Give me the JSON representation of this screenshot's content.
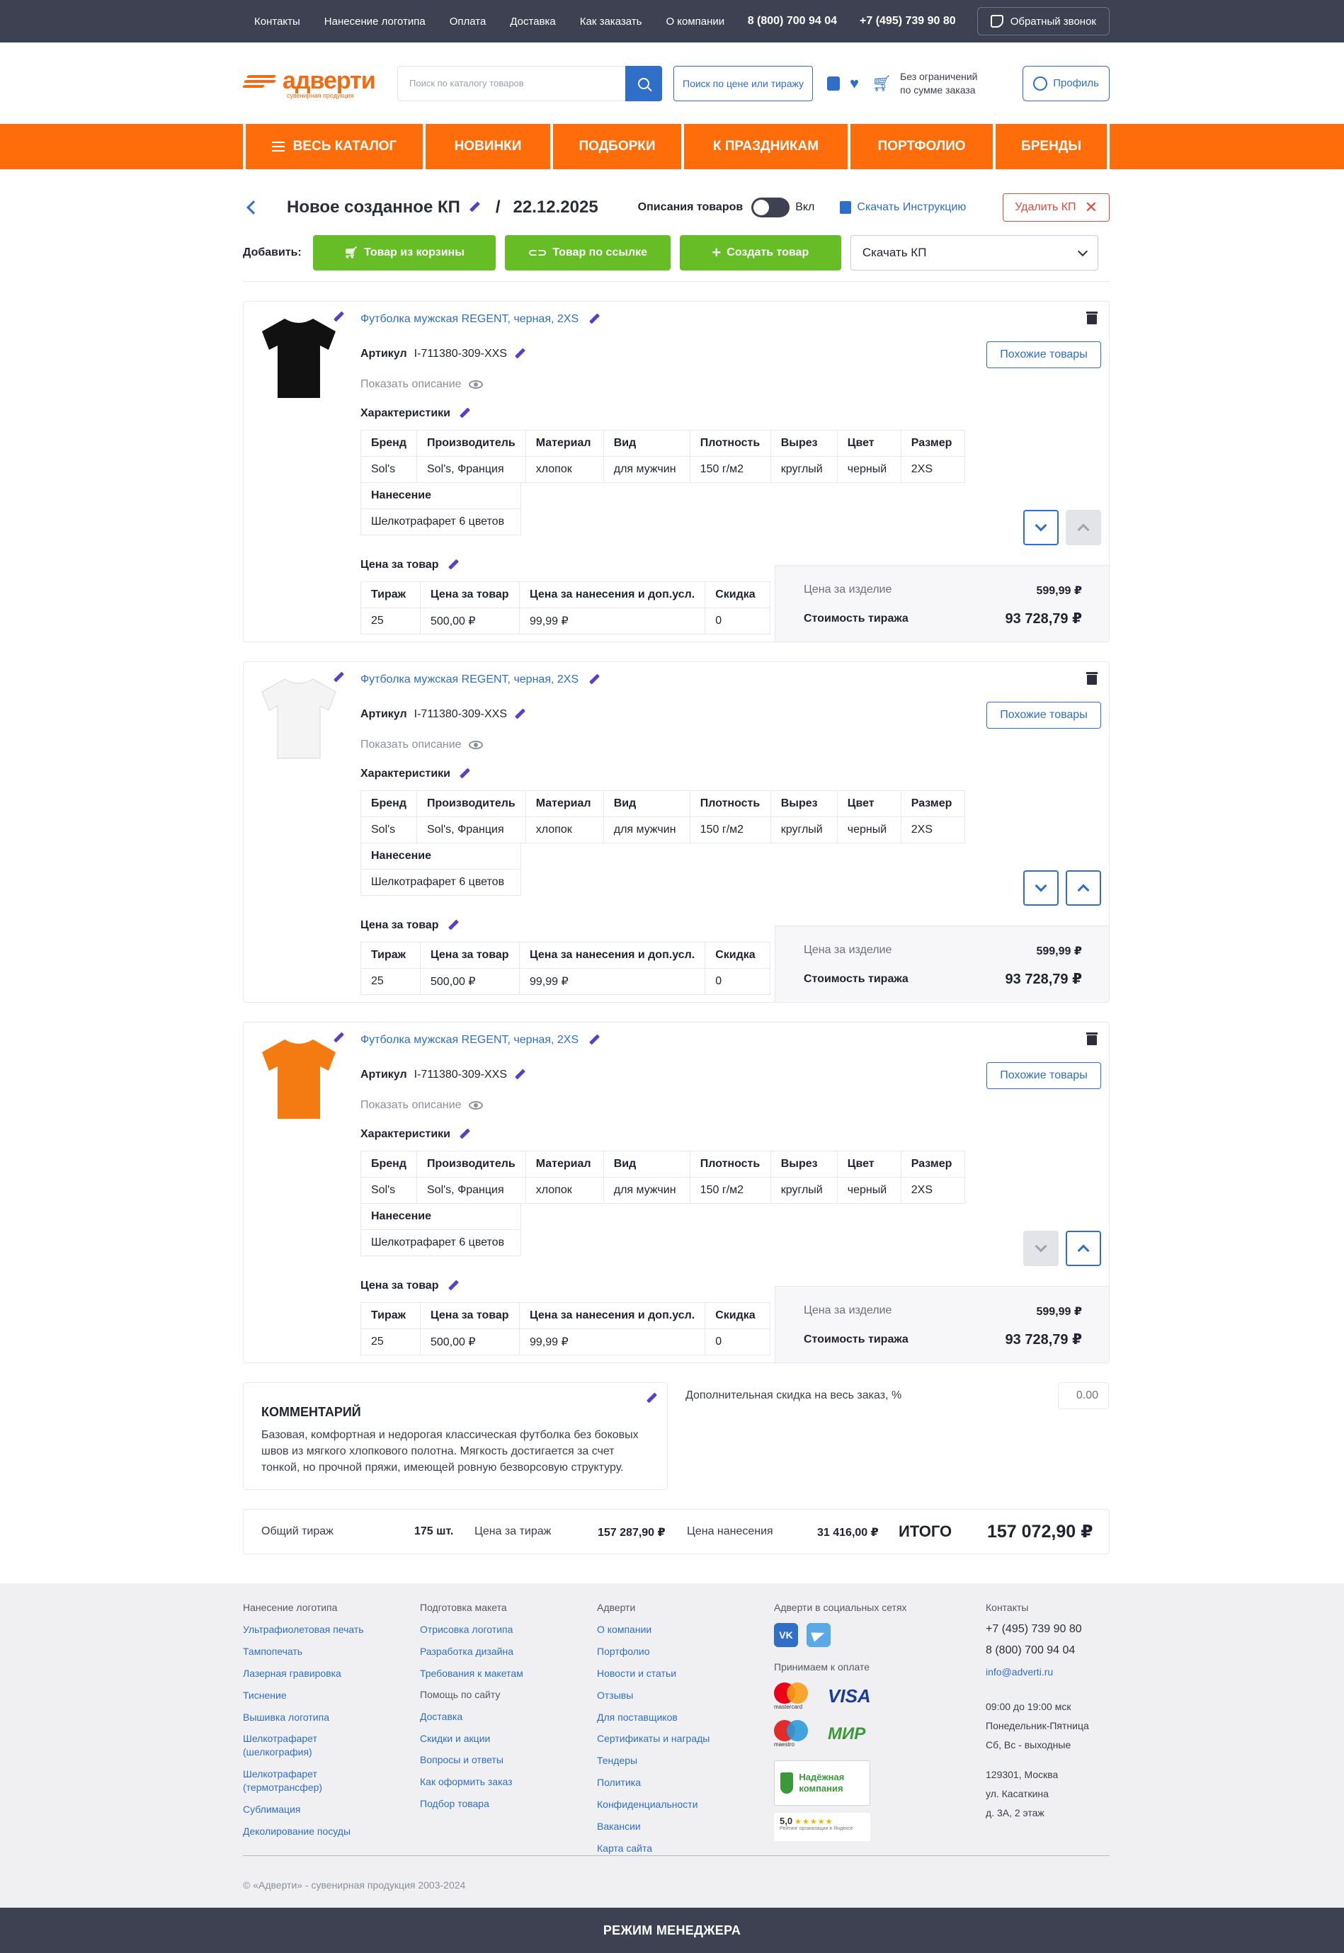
{
  "topbar": {
    "nav": [
      "Контакты",
      "Нанесение логотипа",
      "Оплата",
      "Доставка",
      "Как заказать",
      "О компании"
    ],
    "phone1": "8 (800) 700 94 04",
    "phone2": "+7 (495) 739 90 80",
    "callback": "Обратный звонок"
  },
  "header": {
    "logo_name": "адверти",
    "logo_sub": "сувенирная продукция",
    "search_placeholder": "Поиск по каталогу товаров",
    "price_search": "Поиск по цене или тиражу",
    "cart_line1": "Без ограничений",
    "cart_line2": "по сумме заказа",
    "profile": "Профиль"
  },
  "menu": [
    "ВЕСЬ КАТАЛОГ",
    "НОВИНКИ",
    "ПОДБОРКИ",
    "К ПРАЗДНИКАМ",
    "ПОРТФОЛИО",
    "БРЕНДЫ"
  ],
  "kp": {
    "title": "Новое созданное КП",
    "separator": "/",
    "date": "22.12.2025",
    "desc_label": "Описания товаров",
    "toggle_value": "Вкл",
    "instruction": "Скачать Инструкцию",
    "delete": "Удалить КП",
    "add_label": "Добавить:",
    "add_from_cart": "Товар из корзины",
    "add_by_link": "Товар по ссылке",
    "create_item": "Создать товар",
    "download": "Скачать КП"
  },
  "products": [
    {
      "name": "Футболка мужская REGENT, черная, 2XS",
      "sku_label": "Артикул",
      "sku": "I-711380-309-XXS",
      "shirt_color": "#111111",
      "similar": "Похожие товары",
      "show_desc": "Показать описание",
      "chars_title": "Характеристики",
      "chars_head": [
        "Бренд",
        "Производитель",
        "Материал",
        "Вид",
        "Плотность",
        "Вырез",
        "Цвет",
        "Размер"
      ],
      "chars_vals": [
        "Sol's",
        "Sol's, Франция",
        "хлопок",
        "для мужчин",
        "150 г/м2",
        "круглый",
        "черный",
        "2XS"
      ],
      "nanes_head": "Нанесение",
      "nanes_val": "Шелкотрафарет 6 цветов",
      "price_title": "Цена за товар",
      "price_head": [
        "Тираж",
        "Цена за товар",
        "Цена за нанесения и доп.усл.",
        "Скидка"
      ],
      "price_vals": [
        "25",
        "500,00 ₽",
        "99,99 ₽",
        "0"
      ],
      "unit_label": "Цена за изделие",
      "unit_price": "599,99 ₽",
      "total_label": "Стоимость тиража",
      "total": "93 728,79 ₽"
    },
    {
      "name": "Футболка мужская REGENT, черная, 2XS",
      "sku_label": "Артикул",
      "sku": "I-711380-309-XXS",
      "shirt_color": "#f4f4f4",
      "similar": "Похожие товары",
      "show_desc": "Показать описание",
      "chars_title": "Характеристики",
      "chars_head": [
        "Бренд",
        "Производитель",
        "Материал",
        "Вид",
        "Плотность",
        "Вырез",
        "Цвет",
        "Размер"
      ],
      "chars_vals": [
        "Sol's",
        "Sol's, Франция",
        "хлопок",
        "для мужчин",
        "150 г/м2",
        "круглый",
        "черный",
        "2XS"
      ],
      "nanes_head": "Нанесение",
      "nanes_val": "Шелкотрафарет 6 цветов",
      "price_title": "Цена за товар",
      "price_head": [
        "Тираж",
        "Цена за товар",
        "Цена за нанесения и доп.усл.",
        "Скидка"
      ],
      "price_vals": [
        "25",
        "500,00 ₽",
        "99,99 ₽",
        "0"
      ],
      "unit_label": "Цена за изделие",
      "unit_price": "599,99 ₽",
      "total_label": "Стоимость тиража",
      "total": "93 728,79 ₽"
    },
    {
      "name": "Футболка мужская REGENT, черная, 2XS",
      "sku_label": "Артикул",
      "sku": "I-711380-309-XXS",
      "shirt_color": "#f47a12",
      "similar": "Похожие товары",
      "show_desc": "Показать описание",
      "chars_title": "Характеристики",
      "chars_head": [
        "Бренд",
        "Производитель",
        "Материал",
        "Вид",
        "Плотность",
        "Вырез",
        "Цвет",
        "Размер"
      ],
      "chars_vals": [
        "Sol's",
        "Sol's, Франция",
        "хлопок",
        "для мужчин",
        "150 г/м2",
        "круглый",
        "черный",
        "2XS"
      ],
      "nanes_head": "Нанесение",
      "nanes_val": "Шелкотрафарет 6 цветов",
      "price_title": "Цена за товар",
      "price_head": [
        "Тираж",
        "Цена за товар",
        "Цена за нанесения и доп.усл.",
        "Скидка"
      ],
      "price_vals": [
        "25",
        "500,00 ₽",
        "99,99 ₽",
        "0"
      ],
      "unit_label": "Цена за изделие",
      "unit_price": "599,99 ₽",
      "total_label": "Стоимость тиража",
      "total": "93 728,79 ₽"
    }
  ],
  "comment": {
    "title": "КОММЕНТАРИЙ",
    "text": "Базовая, комфортная и недорогая классическая футболка без боковых швов из мягкого хлопкового полотна. Мягкость достигается за счет тонкой, но прочной пряжи, имеющей ровную безворсовую структуру."
  },
  "discount": {
    "label": "Дополнительная скидка на весь заказ, %",
    "placeholder": "0.00"
  },
  "totals": {
    "qty_label": "Общий тираж",
    "qty": "175 шт.",
    "price_label": "Цена за  тираж",
    "price": "157 287,90 ₽",
    "print_label": "Цена нанесения",
    "print": "31 416,00 ₽",
    "itogo_label": "ИТОГО",
    "itogo": "157 072,90 ₽"
  },
  "footer": {
    "col1": {
      "title": "Нанесение логотипа",
      "links": [
        "Ультрафиолетовая печать",
        "Тампопечать",
        "Лазерная гравировка",
        "Тиснение",
        "Вышивка логотипа",
        "Шелкотрафарет (шелкография)",
        "Шелкотрафарет (термотрансфер)",
        "Сублимация",
        "Деколирование посуды"
      ]
    },
    "col2": {
      "title": "Подготовка макета",
      "links": [
        "Отрисовка логотипа",
        "Разработка дизайна",
        "Требования к макетам"
      ],
      "title2": "Помощь по сайту",
      "links2": [
        "Доставка",
        "Скидки и акции",
        "Вопросы и ответы",
        "Как оформить заказ",
        "Подбор товара"
      ]
    },
    "col3": {
      "title": "Адверти",
      "links": [
        "О компании",
        "Портфолио",
        "Новости и статьи",
        "Отзывы",
        "Для поставщиков",
        "Сертификаты и награды",
        "Тендеры",
        "Политика",
        "Конфиденциальности",
        "Вакансии",
        "Карта сайта"
      ]
    },
    "col4": {
      "title": "Адверти в социальных сетях",
      "vk": "VK",
      "pay_title": "Принимаем к оплате",
      "mastercard": "mastercard",
      "visa": "VISA",
      "maestro": "maestro",
      "mir": "МИР",
      "trust": "Надёжная компания",
      "rating": "5,0",
      "stars": "★★★★★",
      "rating_text": "Рейтинг организации в Яндексе"
    },
    "col5": {
      "title": "Контакты",
      "phone1": "+7 (495) 739 90 80",
      "phone2": "8 (800) 700 94 04",
      "email": "info@adverti.ru",
      "hours": "09:00 до 19:00 мск",
      "days": "Понедельник-Пятница",
      "weekend": "Сб, Вс - выходные",
      "addr1": "129301, Москва",
      "addr2": "ул. Касаткина",
      "addr3": "д. 3А, 2 этаж"
    },
    "copyright": "© «Адверти» - сувенирная продукция 2003-2024"
  },
  "manager_mode": "РЕЖИМ МЕНЕДЖЕРА",
  "colors": {
    "accent": "#ff6d0a",
    "primary": "#2f6fc7",
    "green": "#66bd26",
    "dark": "#3d4152",
    "danger": "#e24a3a"
  }
}
